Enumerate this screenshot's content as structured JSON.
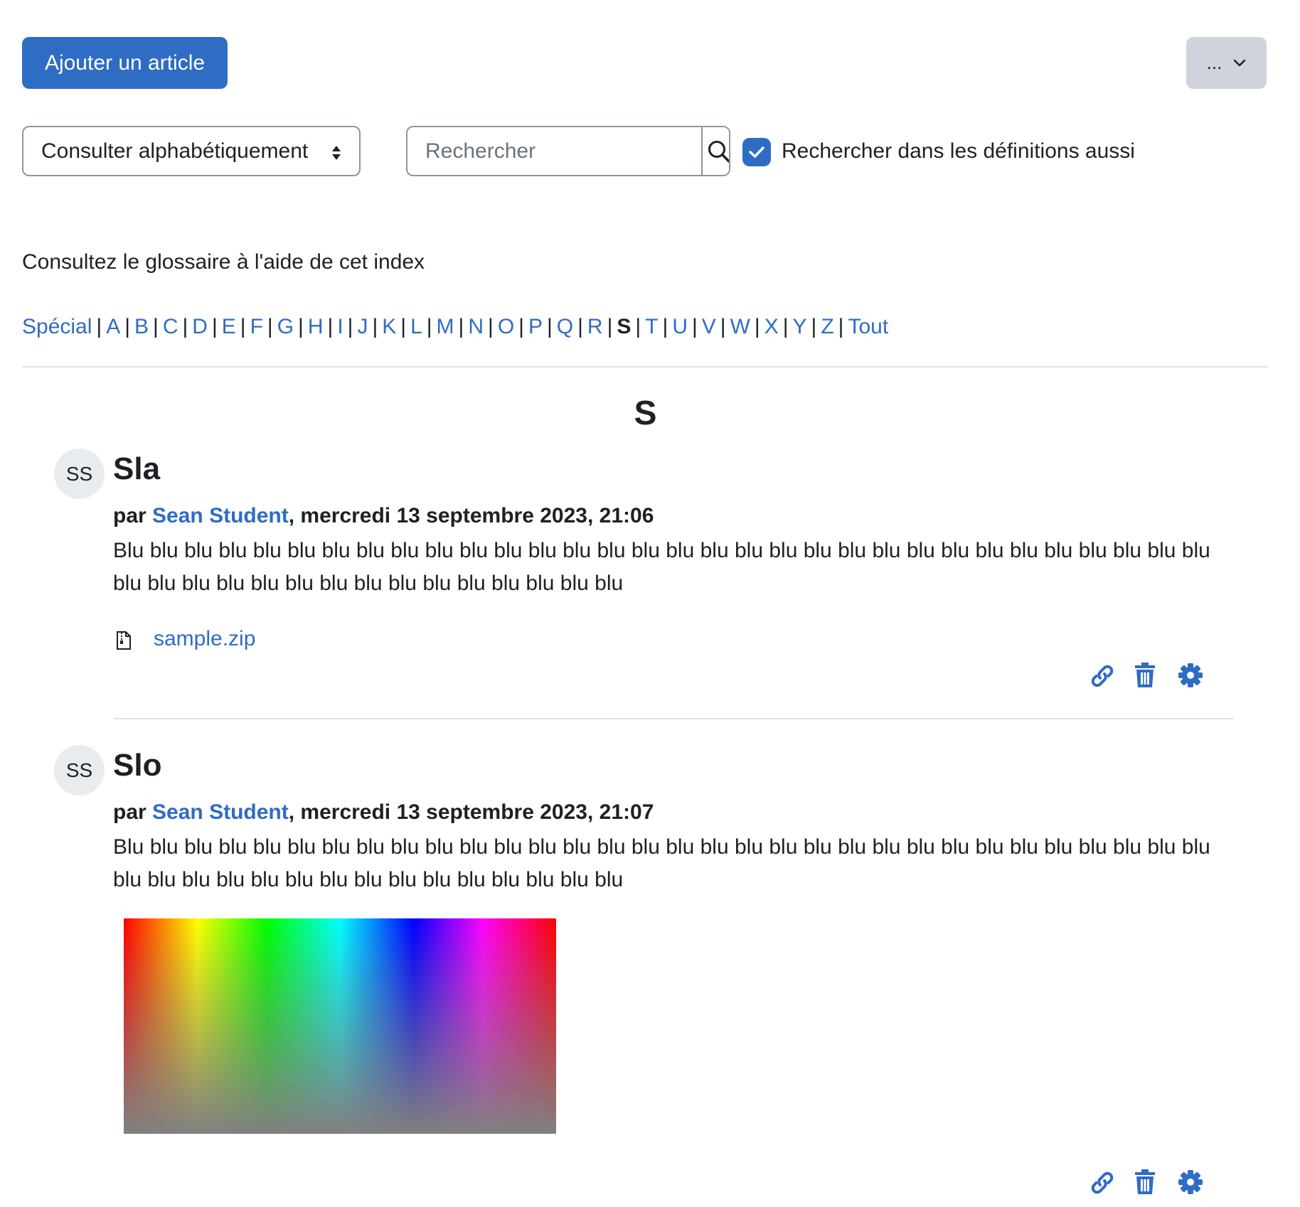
{
  "toolbar": {
    "add_entry_label": "Ajouter un article",
    "more_label": "..."
  },
  "browse_select": {
    "value": "Consulter alphabétiquement"
  },
  "search": {
    "placeholder": "Rechercher",
    "value": "",
    "full_search_checked": true,
    "full_search_label": "Rechercher dans les définitions aussi"
  },
  "intro_text": "Consultez le glossaire à l'aide de cet index",
  "alphabet": {
    "special": "Spécial",
    "letters": [
      "A",
      "B",
      "C",
      "D",
      "E",
      "F",
      "G",
      "H",
      "I",
      "J",
      "K",
      "L",
      "M",
      "N",
      "O",
      "P",
      "Q",
      "R",
      "S",
      "T",
      "U",
      "V",
      "W",
      "X",
      "Y",
      "Z"
    ],
    "current": "S",
    "all": "Tout"
  },
  "section_letter": "S",
  "entries": [
    {
      "initials": "SS",
      "title": "Sla",
      "by_prefix": "par ",
      "author": "Sean Student",
      "date": ", mercredi 13 septembre 2023, 21:06",
      "body": "Blu blu blu blu blu blu blu blu blu blu blu blu blu blu blu blu blu blu blu blu blu blu blu blu blu blu blu blu blu blu blu blu blu blu blu blu blu blu blu blu blu blu blu blu blu blu blu",
      "attachment": "sample.zip"
    },
    {
      "initials": "SS",
      "title": "Slo",
      "by_prefix": "par ",
      "author": "Sean Student",
      "date": ", mercredi 13 septembre 2023, 21:07",
      "body": "Blu blu blu blu blu blu blu blu blu blu blu blu blu blu blu blu blu blu blu blu blu blu blu blu blu blu blu blu blu blu blu blu blu blu blu blu blu blu blu blu blu blu blu blu blu blu blu",
      "image": "color-gradient-image"
    }
  ],
  "colors": {
    "primary": "#2f6cc3",
    "text": "#1d2125",
    "secondary_button": "#ced4da",
    "avatar_bg": "#e9ecef",
    "divider": "#dee2e6"
  },
  "icons": [
    "chevron-down-icon",
    "sort-updown-icon",
    "search-icon",
    "check-icon",
    "zip-file-icon",
    "link-icon",
    "trash-icon",
    "gear-icon"
  ]
}
